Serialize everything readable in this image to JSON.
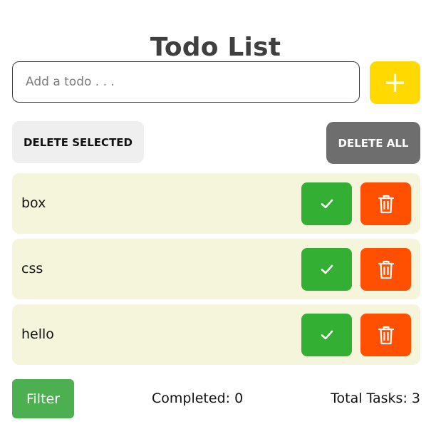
{
  "title": "Todo List",
  "input": {
    "placeholder": "Add a todo . . .",
    "value": ""
  },
  "add_button": {
    "label": "+",
    "color": "#ffd900",
    "icon": "plus-icon"
  },
  "actions": {
    "delete_selected_label": "DELETE SELECTED",
    "delete_all_label": "DELETE ALL"
  },
  "todos": [
    {
      "text": "box"
    },
    {
      "text": "css"
    },
    {
      "text": "hello"
    }
  ],
  "todo_buttons": {
    "complete_icon": "check-icon",
    "complete_color": "#33b033",
    "delete_icon": "trash-icon",
    "delete_color": "#ff4f00"
  },
  "footer": {
    "filter_label": "Filter",
    "completed_text": "Completed: 0",
    "total_text": "Total Tasks: 3"
  },
  "colors": {
    "todo_background": "#f5f5dc",
    "title": "#3f3f3f"
  }
}
